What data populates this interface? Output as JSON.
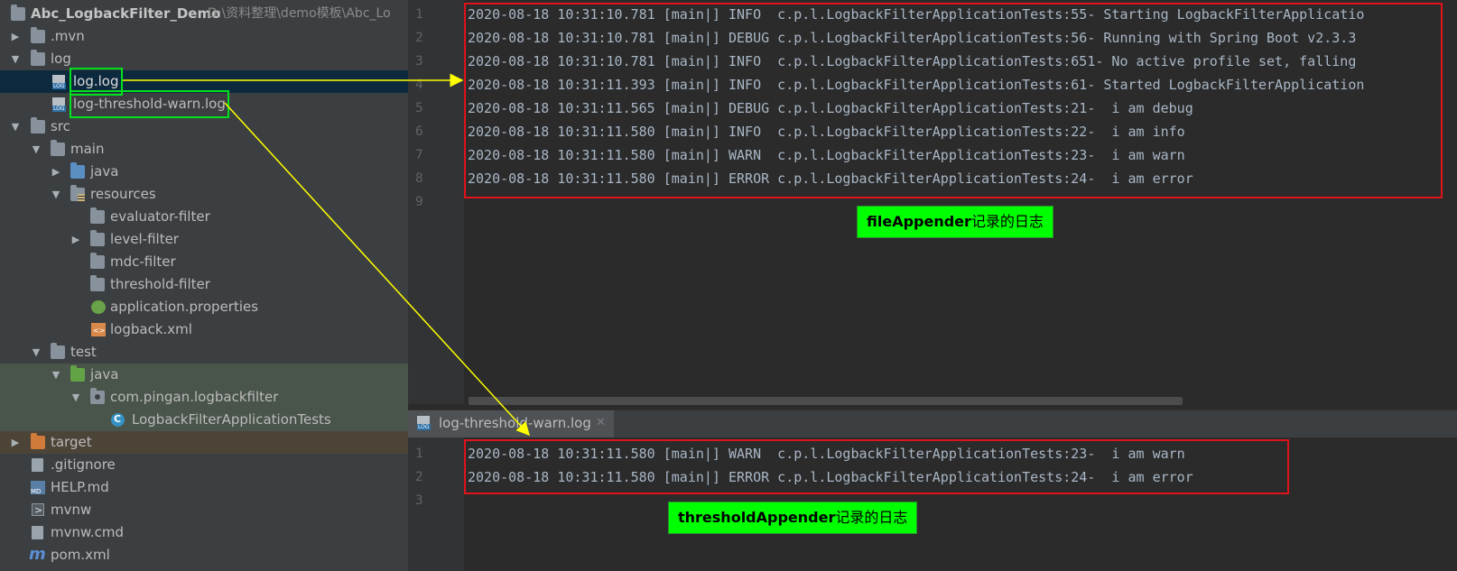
{
  "project_tree": {
    "project_name": "Abc_LogbackFilter_Demo",
    "project_path": "D:\\资料整理\\demo模板\\Abc_Lo",
    "items": [
      {
        "label": ".mvn",
        "icon": "folder-icon"
      },
      {
        "label": "log",
        "icon": "folder-icon"
      },
      {
        "label": "log.log",
        "icon": "log-file-icon"
      },
      {
        "label": "log-threshold-warn.log",
        "icon": "log-file-icon"
      },
      {
        "label": "src",
        "icon": "folder-icon"
      },
      {
        "label": "main",
        "icon": "folder-icon"
      },
      {
        "label": "java",
        "icon": "source-folder-icon"
      },
      {
        "label": "resources",
        "icon": "resources-folder-icon"
      },
      {
        "label": "evaluator-filter",
        "icon": "folder-icon"
      },
      {
        "label": "level-filter",
        "icon": "folder-icon"
      },
      {
        "label": "mdc-filter",
        "icon": "folder-icon"
      },
      {
        "label": "threshold-filter",
        "icon": "folder-icon"
      },
      {
        "label": "application.properties",
        "icon": "properties-file-icon"
      },
      {
        "label": "logback.xml",
        "icon": "xml-file-icon"
      },
      {
        "label": "test",
        "icon": "folder-icon"
      },
      {
        "label": "java",
        "icon": "test-source-folder-icon"
      },
      {
        "label": "com.pingan.logbackfilter",
        "icon": "package-icon"
      },
      {
        "label": "LogbackFilterApplicationTests",
        "icon": "class-icon"
      },
      {
        "label": "target",
        "icon": "excluded-folder-icon"
      },
      {
        "label": ".gitignore",
        "icon": "text-file-icon"
      },
      {
        "label": "HELP.md",
        "icon": "markdown-file-icon"
      },
      {
        "label": "mvnw",
        "icon": "script-file-icon"
      },
      {
        "label": "mvnw.cmd",
        "icon": "text-file-icon"
      },
      {
        "label": "pom.xml",
        "icon": "maven-icon"
      }
    ]
  },
  "editor_top": {
    "line_numbers": [
      "1",
      "2",
      "3",
      "4",
      "5",
      "6",
      "7",
      "8",
      "9"
    ],
    "lines": [
      "2020-08-18 10:31:10.781 [main|] INFO  c.p.l.LogbackFilterApplicationTests:55- Starting LogbackFilterApplicatio",
      "2020-08-18 10:31:10.781 [main|] DEBUG c.p.l.LogbackFilterApplicationTests:56- Running with Spring Boot v2.3.3",
      "2020-08-18 10:31:10.781 [main|] INFO  c.p.l.LogbackFilterApplicationTests:651- No active profile set, falling",
      "2020-08-18 10:31:11.393 [main|] INFO  c.p.l.LogbackFilterApplicationTests:61- Started LogbackFilterApplication",
      "2020-08-18 10:31:11.565 [main|] DEBUG c.p.l.LogbackFilterApplicationTests:21-  i am debug",
      "2020-08-18 10:31:11.580 [main|] INFO  c.p.l.LogbackFilterApplicationTests:22-  i am info",
      "2020-08-18 10:31:11.580 [main|] WARN  c.p.l.LogbackFilterApplicationTests:23-  i am warn",
      "2020-08-18 10:31:11.580 [main|] ERROR c.p.l.LogbackFilterApplicationTests:24-  i am error",
      ""
    ]
  },
  "editor_bottom": {
    "tab_label": "log-threshold-warn.log",
    "close_glyph": "✕",
    "line_numbers": [
      "1",
      "2",
      "3"
    ],
    "lines": [
      "2020-08-18 10:31:11.580 [main|] WARN  c.p.l.LogbackFilterApplicationTests:23-  i am warn",
      "2020-08-18 10:31:11.580 [main|] ERROR c.p.l.LogbackFilterApplicationTests:24-  i am error",
      ""
    ]
  },
  "annotations": {
    "file_appender_bold": "fileAppender",
    "file_appender_rest": "记录的日志",
    "threshold_appender_bold": "thresholdAppender",
    "threshold_appender_rest": "记录的日志",
    "highlight_color": "#00ff00",
    "box_color": "#e0131a",
    "arrow_color": "#ffff00"
  }
}
